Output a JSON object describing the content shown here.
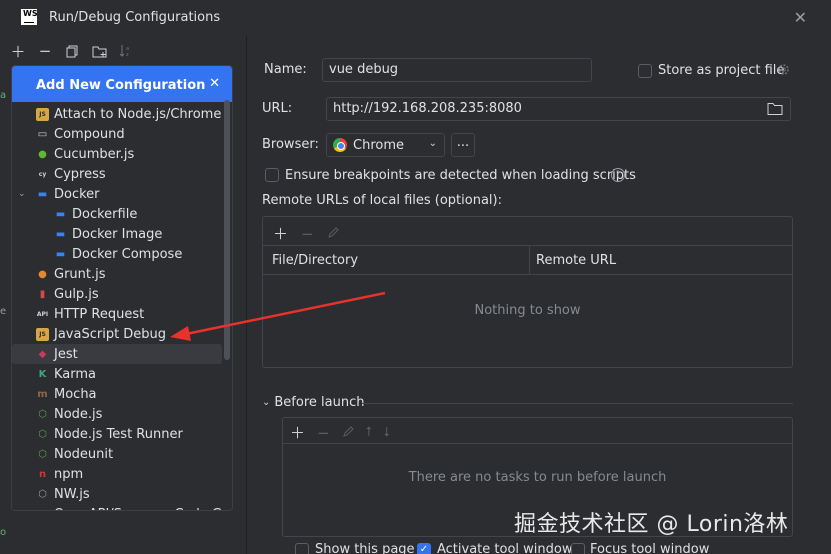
{
  "window": {
    "title": "Run/Debug Configurations",
    "logo_text": "WS"
  },
  "popup": {
    "header": "Add New Configuration",
    "items": [
      {
        "label": "Attach to Node.js/Chrome",
        "icon": "js-icon",
        "color": "#d8a645",
        "glyph": "JS",
        "indent": 0
      },
      {
        "label": "Compound",
        "icon": "folder-icon",
        "color": "#ced0d6",
        "glyph": "▭",
        "indent": 0
      },
      {
        "label": "Cucumber.js",
        "icon": "cucumber-icon",
        "color": "#5fb832",
        "glyph": "●",
        "indent": 0
      },
      {
        "label": "Cypress",
        "icon": "cypress-icon",
        "color": "#ced0d6",
        "glyph": "cy",
        "indent": 0
      },
      {
        "label": "Docker",
        "icon": "docker-icon",
        "color": "#3b82f6",
        "glyph": "▬",
        "indent": 0,
        "expanded": true
      },
      {
        "label": "Dockerfile",
        "icon": "docker-icon",
        "color": "#3b82f6",
        "glyph": "▬",
        "indent": 1
      },
      {
        "label": "Docker Image",
        "icon": "docker-icon",
        "color": "#3b82f6",
        "glyph": "▬",
        "indent": 1
      },
      {
        "label": "Docker Compose",
        "icon": "docker-icon",
        "color": "#3b82f6",
        "glyph": "▬",
        "indent": 1
      },
      {
        "label": "Grunt.js",
        "icon": "grunt-icon",
        "color": "#e48632",
        "glyph": "●",
        "indent": 0
      },
      {
        "label": "Gulp.js",
        "icon": "gulp-icon",
        "color": "#d34a47",
        "glyph": "▮",
        "indent": 0
      },
      {
        "label": "HTTP Request",
        "icon": "api-icon",
        "color": "#ced0d6",
        "glyph": "API",
        "indent": 0
      },
      {
        "label": "JavaScript Debug",
        "icon": "js-icon",
        "color": "#d8a645",
        "glyph": "JS",
        "indent": 0
      },
      {
        "label": "Jest",
        "icon": "jest-icon",
        "color": "#c63d5a",
        "glyph": "◆",
        "indent": 0,
        "selected": true
      },
      {
        "label": "Karma",
        "icon": "karma-icon",
        "color": "#3ba77a",
        "glyph": "K",
        "indent": 0
      },
      {
        "label": "Mocha",
        "icon": "mocha-icon",
        "color": "#8d6748",
        "glyph": "m",
        "indent": 0
      },
      {
        "label": "Node.js",
        "icon": "nodejs-icon",
        "color": "#5fa04e",
        "glyph": "⬡",
        "indent": 0
      },
      {
        "label": "Node.js Test Runner",
        "icon": "nodejs-icon",
        "color": "#5fa04e",
        "glyph": "⬡",
        "indent": 0
      },
      {
        "label": "Nodeunit",
        "icon": "nodejs-icon",
        "color": "#5fa04e",
        "glyph": "⬡",
        "indent": 0
      },
      {
        "label": "npm",
        "icon": "npm-icon",
        "color": "#cb3837",
        "glyph": "n",
        "indent": 0
      },
      {
        "label": "NW.js",
        "icon": "nwjs-icon",
        "color": "#9a9da3",
        "glyph": "⬡",
        "indent": 0
      },
      {
        "label": "OpenAPI/Swagger Code Generator",
        "icon": "openapi-icon",
        "color": "#5fa04e",
        "glyph": "●",
        "indent": 0
      }
    ]
  },
  "form": {
    "name_label": "Name:",
    "name_value": "vue debug",
    "store_label": "Store as project file",
    "url_label": "URL:",
    "url_value": "http://192.168.208.235:8080",
    "browser_label": "Browser:",
    "browser_value": "Chrome",
    "more_label": "...",
    "ensure_label": "Ensure breakpoints are detected when loading scripts",
    "remote_urls_label": "Remote URLs of local files (optional):",
    "col_file": "File/Directory",
    "col_remote": "Remote URL",
    "nothing": "Nothing to show",
    "before_launch": "Before launch",
    "no_tasks": "There are no tasks to run before launch",
    "show_page": "Show this page",
    "activate_tool": "Activate tool window",
    "focus_tool": "Focus tool window"
  },
  "watermark": "掘金技术社区 @ Lorin洛林",
  "colors": {
    "accent": "#3574f0",
    "annotation_arrow": "#e8322b"
  }
}
